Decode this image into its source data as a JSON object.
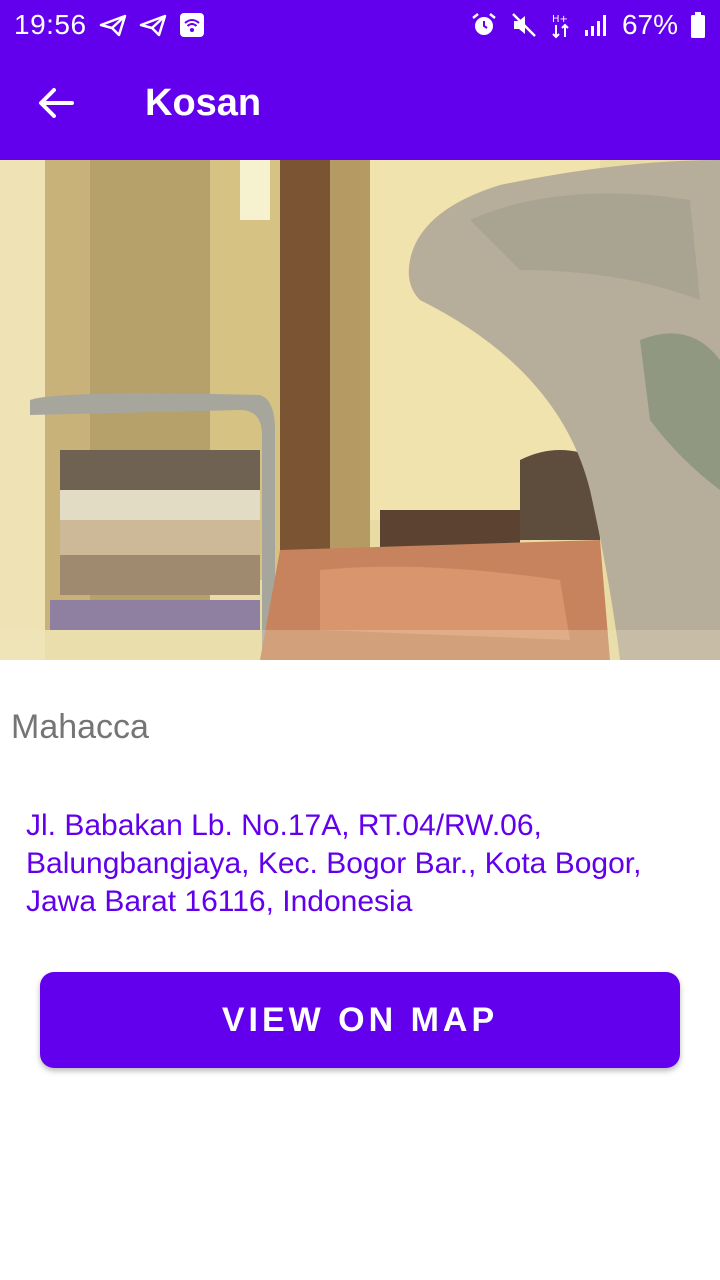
{
  "status_bar": {
    "time": "19:56",
    "battery_percent": "67%",
    "icons": [
      "telegram-icon",
      "telegram-icon",
      "wifi-box-icon",
      "alarm-icon",
      "mute-icon",
      "data-arrows-icon",
      "signal-icon",
      "battery-icon"
    ]
  },
  "app_bar": {
    "title": "Kosan",
    "back_icon": "arrow-left-icon"
  },
  "detail": {
    "photo_icon": "room-photo",
    "name": "Mahacca",
    "address": "Jl. Babakan Lb. No.17A, RT.04/RW.06, Balungbangjaya, Kec. Bogor Bar., Kota Bogor, Jawa Barat 16116, Indonesia",
    "button_label": "VIEW ON MAP"
  },
  "colors": {
    "primary": "#6200ee",
    "on_primary": "#ffffff",
    "secondary_text": "#757575"
  }
}
